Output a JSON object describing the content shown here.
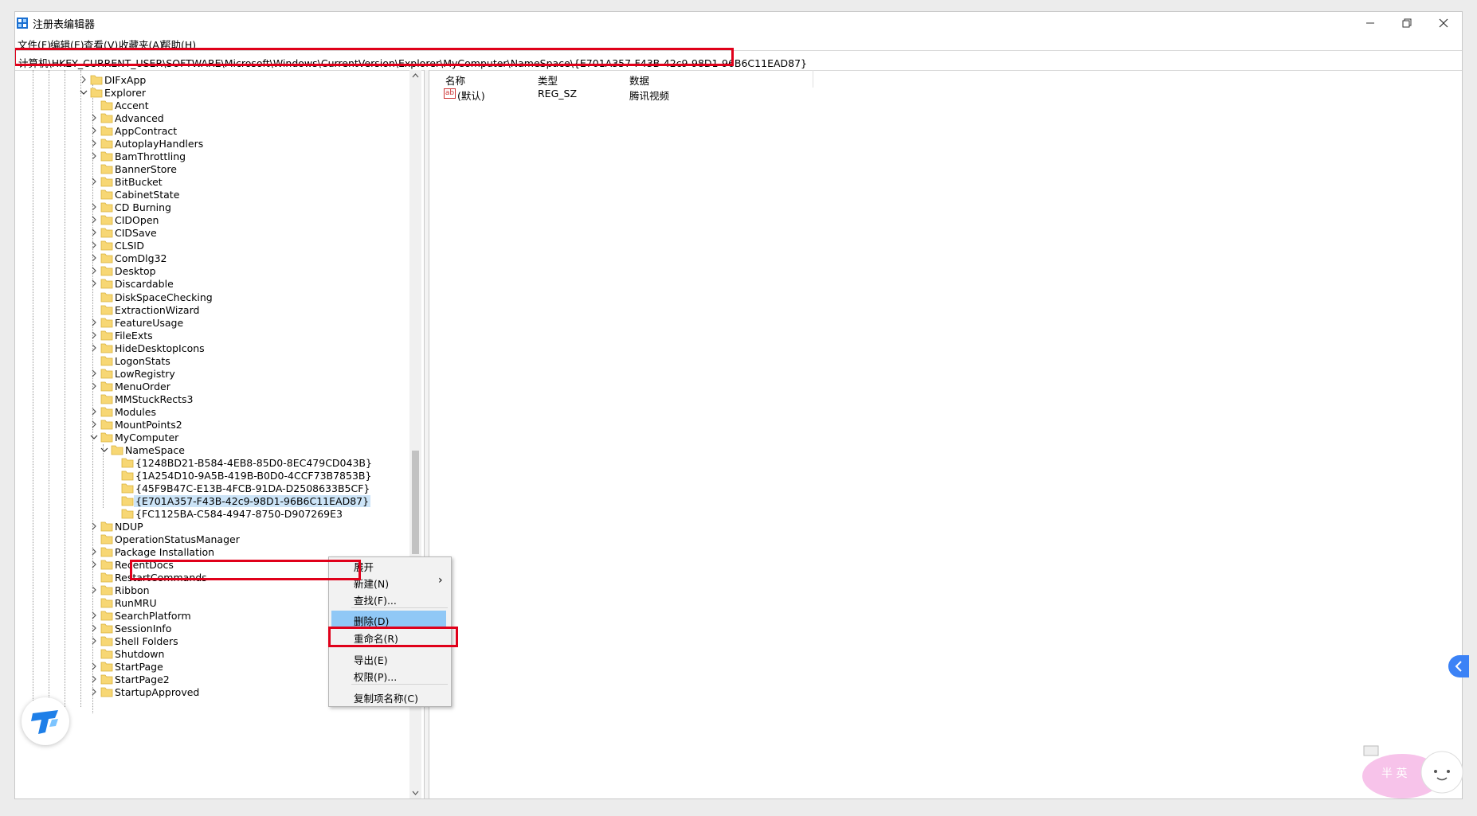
{
  "window": {
    "title": "注册表编辑器",
    "controls": {
      "minimize": "–",
      "maximize": "⧉",
      "close": "✕"
    }
  },
  "menu": [
    "文件(F)",
    "编辑(E)",
    "查看(V)",
    "收藏夹(A)",
    "帮助(H)"
  ],
  "address": "计算机\\HKEY_CURRENT_USER\\SOFTWARE\\Microsoft\\Windows\\CurrentVersion\\Explorer\\MyComputer\\NameSpace\\{E701A357-F43B-42c9-98D1-96B6C11EAD87}",
  "tree": [
    {
      "label": "DIFxApp",
      "depth": 0,
      "expander": "collapsed"
    },
    {
      "label": "Explorer",
      "depth": 0,
      "expander": "expanded"
    },
    {
      "label": "Accent",
      "depth": 1,
      "expander": "none"
    },
    {
      "label": "Advanced",
      "depth": 1,
      "expander": "collapsed"
    },
    {
      "label": "AppContract",
      "depth": 1,
      "expander": "collapsed"
    },
    {
      "label": "AutoplayHandlers",
      "depth": 1,
      "expander": "collapsed"
    },
    {
      "label": "BamThrottling",
      "depth": 1,
      "expander": "collapsed"
    },
    {
      "label": "BannerStore",
      "depth": 1,
      "expander": "none"
    },
    {
      "label": "BitBucket",
      "depth": 1,
      "expander": "collapsed"
    },
    {
      "label": "CabinetState",
      "depth": 1,
      "expander": "none"
    },
    {
      "label": "CD Burning",
      "depth": 1,
      "expander": "collapsed"
    },
    {
      "label": "CIDOpen",
      "depth": 1,
      "expander": "collapsed"
    },
    {
      "label": "CIDSave",
      "depth": 1,
      "expander": "collapsed"
    },
    {
      "label": "CLSID",
      "depth": 1,
      "expander": "collapsed"
    },
    {
      "label": "ComDlg32",
      "depth": 1,
      "expander": "collapsed"
    },
    {
      "label": "Desktop",
      "depth": 1,
      "expander": "collapsed"
    },
    {
      "label": "Discardable",
      "depth": 1,
      "expander": "collapsed"
    },
    {
      "label": "DiskSpaceChecking",
      "depth": 1,
      "expander": "none"
    },
    {
      "label": "ExtractionWizard",
      "depth": 1,
      "expander": "none"
    },
    {
      "label": "FeatureUsage",
      "depth": 1,
      "expander": "collapsed"
    },
    {
      "label": "FileExts",
      "depth": 1,
      "expander": "collapsed"
    },
    {
      "label": "HideDesktopIcons",
      "depth": 1,
      "expander": "collapsed"
    },
    {
      "label": "LogonStats",
      "depth": 1,
      "expander": "none"
    },
    {
      "label": "LowRegistry",
      "depth": 1,
      "expander": "collapsed"
    },
    {
      "label": "MenuOrder",
      "depth": 1,
      "expander": "collapsed"
    },
    {
      "label": "MMStuckRects3",
      "depth": 1,
      "expander": "none"
    },
    {
      "label": "Modules",
      "depth": 1,
      "expander": "collapsed"
    },
    {
      "label": "MountPoints2",
      "depth": 1,
      "expander": "collapsed"
    },
    {
      "label": "MyComputer",
      "depth": 1,
      "expander": "expanded"
    },
    {
      "label": "NameSpace",
      "depth": 2,
      "expander": "expanded"
    },
    {
      "label": "{1248BD21-B584-4EB8-85D0-8EC479CD043B}",
      "depth": 3,
      "expander": "none"
    },
    {
      "label": "{1A254D10-9A5B-419B-B0D0-4CCF73B7853B}",
      "depth": 3,
      "expander": "none"
    },
    {
      "label": "{45F9B47C-E13B-4FCB-91DA-D2508633B5CF}",
      "depth": 3,
      "expander": "none"
    },
    {
      "label": "{E701A357-F43B-42c9-98D1-96B6C11EAD87}",
      "depth": 3,
      "expander": "none",
      "selected": true
    },
    {
      "label": "{FC1125BA-C584-4947-8750-D907269E3",
      "depth": 3,
      "expander": "none"
    },
    {
      "label": "NDUP",
      "depth": 1,
      "expander": "collapsed"
    },
    {
      "label": "OperationStatusManager",
      "depth": 1,
      "expander": "none"
    },
    {
      "label": "Package Installation",
      "depth": 1,
      "expander": "collapsed"
    },
    {
      "label": "RecentDocs",
      "depth": 1,
      "expander": "collapsed"
    },
    {
      "label": "RestartCommands",
      "depth": 1,
      "expander": "none"
    },
    {
      "label": "Ribbon",
      "depth": 1,
      "expander": "collapsed"
    },
    {
      "label": "RunMRU",
      "depth": 1,
      "expander": "none"
    },
    {
      "label": "SearchPlatform",
      "depth": 1,
      "expander": "collapsed"
    },
    {
      "label": "SessionInfo",
      "depth": 1,
      "expander": "collapsed"
    },
    {
      "label": "Shell Folders",
      "depth": 1,
      "expander": "collapsed"
    },
    {
      "label": "Shutdown",
      "depth": 1,
      "expander": "none"
    },
    {
      "label": "StartPage",
      "depth": 1,
      "expander": "collapsed"
    },
    {
      "label": "StartPage2",
      "depth": 1,
      "expander": "collapsed"
    },
    {
      "label": "StartupApproved",
      "depth": 1,
      "expander": "collapsed"
    }
  ],
  "values_pane": {
    "columns": [
      "名称",
      "类型",
      "数据"
    ],
    "rows": [
      {
        "icon": "string-value-icon",
        "icon_text": "ab",
        "name": "(默认)",
        "type": "REG_SZ",
        "data": "腾讯视频"
      }
    ]
  },
  "context_menu": {
    "items": [
      {
        "label": "展开",
        "id": "expand"
      },
      {
        "label": "新建(N)",
        "id": "new",
        "submenu": true,
        "arrow": "›"
      },
      {
        "label": "查找(F)...",
        "id": "find"
      },
      {
        "separator": true
      },
      {
        "label": "删除(D)",
        "id": "delete",
        "highlighted": true
      },
      {
        "label": "重命名(R)",
        "id": "rename"
      },
      {
        "separator": true
      },
      {
        "label": "导出(E)",
        "id": "export"
      },
      {
        "label": "权限(P)...",
        "id": "permissions"
      },
      {
        "separator": true
      },
      {
        "label": "复制项名称(C)",
        "id": "copy-key-name"
      }
    ]
  },
  "colors": {
    "highlight_red": "#e0001a",
    "selection": "#cce4f7",
    "menu_highlight": "#90c8f6",
    "folder": "#f7d774",
    "app_blue": "#1e7fe8"
  },
  "overlay": {
    "mascot_text": "半 英"
  }
}
